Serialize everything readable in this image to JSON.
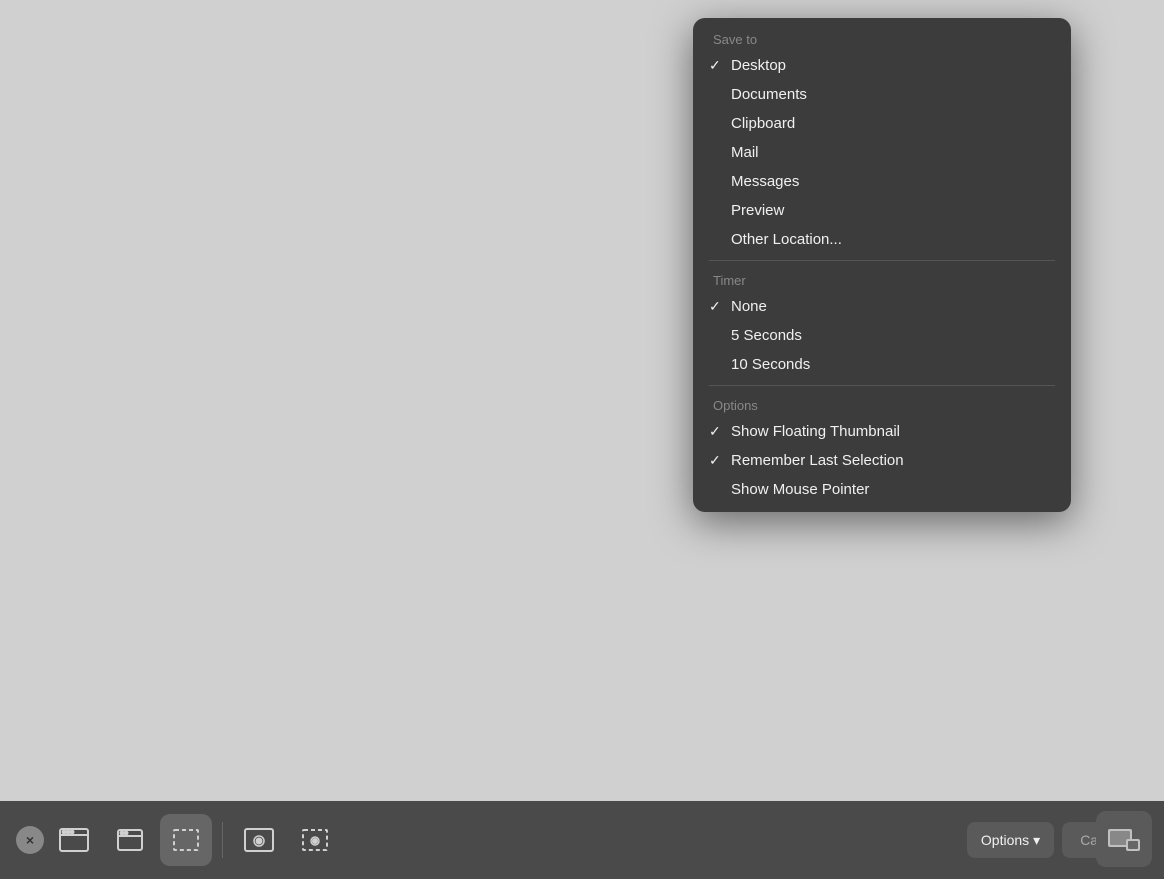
{
  "background": {
    "color": "#d4d4d4"
  },
  "dropdown": {
    "save_to_label": "Save to",
    "save_to_items": [
      {
        "label": "Desktop",
        "checked": true
      },
      {
        "label": "Documents",
        "checked": false
      },
      {
        "label": "Clipboard",
        "checked": false
      },
      {
        "label": "Mail",
        "checked": false
      },
      {
        "label": "Messages",
        "checked": false
      },
      {
        "label": "Preview",
        "checked": false
      },
      {
        "label": "Other Location...",
        "checked": false
      }
    ],
    "timer_label": "Timer",
    "timer_items": [
      {
        "label": "None",
        "checked": true
      },
      {
        "label": "5 Seconds",
        "checked": false
      },
      {
        "label": "10 Seconds",
        "checked": false
      }
    ],
    "options_label": "Options",
    "options_items": [
      {
        "label": "Show Floating Thumbnail",
        "checked": true
      },
      {
        "label": "Remember Last Selection",
        "checked": true
      },
      {
        "label": "Show Mouse Pointer",
        "checked": false
      }
    ]
  },
  "toolbar": {
    "close_label": "×",
    "buttons": [
      {
        "name": "full-screen-capture",
        "tooltip": "Capture Entire Screen"
      },
      {
        "name": "window-capture",
        "tooltip": "Capture Selected Window"
      },
      {
        "name": "selection-capture",
        "tooltip": "Capture Selected Portion"
      },
      {
        "name": "screen-record",
        "tooltip": "Record Entire Screen"
      },
      {
        "name": "selection-record",
        "tooltip": "Record Selected Portion"
      }
    ],
    "active_button": "selection-capture",
    "options_label": "Options",
    "options_chevron": "▾",
    "capture_label": "Capture"
  }
}
